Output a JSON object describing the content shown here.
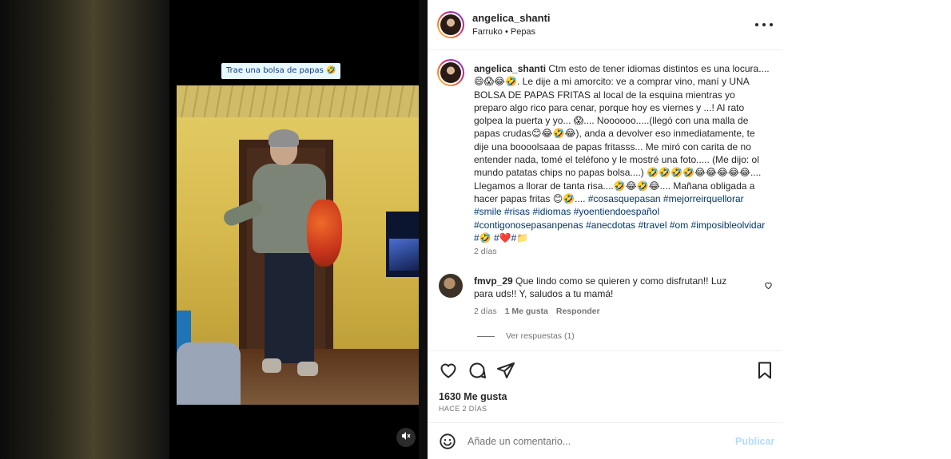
{
  "media": {
    "overlay_caption": "Trae una bolsa de papas 🤣",
    "mute_icon": "muted-speaker-icon"
  },
  "post": {
    "username": "angelica_shanti",
    "audio": "Farruko • Pepas",
    "more_icon": "more-options-icon"
  },
  "caption": {
    "username": "angelica_shanti",
    "text": "Ctm esto de tener idiomas distintos es una locura.... 😄😱😂🤣. Le dije a mi amorcito: ve a comprar vino, maní y UNA BOLSA DE PAPAS FRITAS al local de la esquina mientras yo preparo algo rico para cenar, porque hoy es viernes y ...! Al rato golpea la puerta y yo... 😱.... Noooooo.....(llegó con una malla de papas crudas😊😂🤣😂), anda a devolver eso inmediatamente, te dije una boooolsaaa de papas fritasss... Me miró con carita de no entender nada, tomé el teléfono y le mostré una foto..... (Me dijo: ol mundo patatas chips no papas bolsa....) 🤣🤣🤣🤣😂😂😂😂😂.... Llegamos a llorar de tanta risa....🤣😂🤣😂.... Mañana obligada a hacer papas fritas 😊🤣....",
    "hashtags": "#cosasquepasan #mejorreirquellorar #smile #risas #idiomas #yoentiendoespañol #contigonosepasanpenas #anecdotas #travel #om #imposibleolvidar #🤣 #❤️#📁",
    "time": "2 días"
  },
  "comment": {
    "username": "fmvp_29",
    "text": "Que lindo como se quieren y como disfrutan!! Luz para uds!! Y, saludos a tu mamá!",
    "time": "2 días",
    "likes": "1 Me gusta",
    "reply": "Responder",
    "view_replies": "Ver respuestas (1)"
  },
  "actions": {
    "icons": [
      "heart-icon",
      "comment-icon",
      "share-icon",
      "bookmark-icon"
    ],
    "likes_count": "1630 Me gusta",
    "posted_ago": "HACE 2 DÍAS"
  },
  "composer": {
    "placeholder": "Añade un comentario...",
    "submit": "Publicar"
  },
  "colors": {
    "hashtag": "#00376b",
    "muted_text": "#737373",
    "publish_disabled": "#b3dbff"
  }
}
